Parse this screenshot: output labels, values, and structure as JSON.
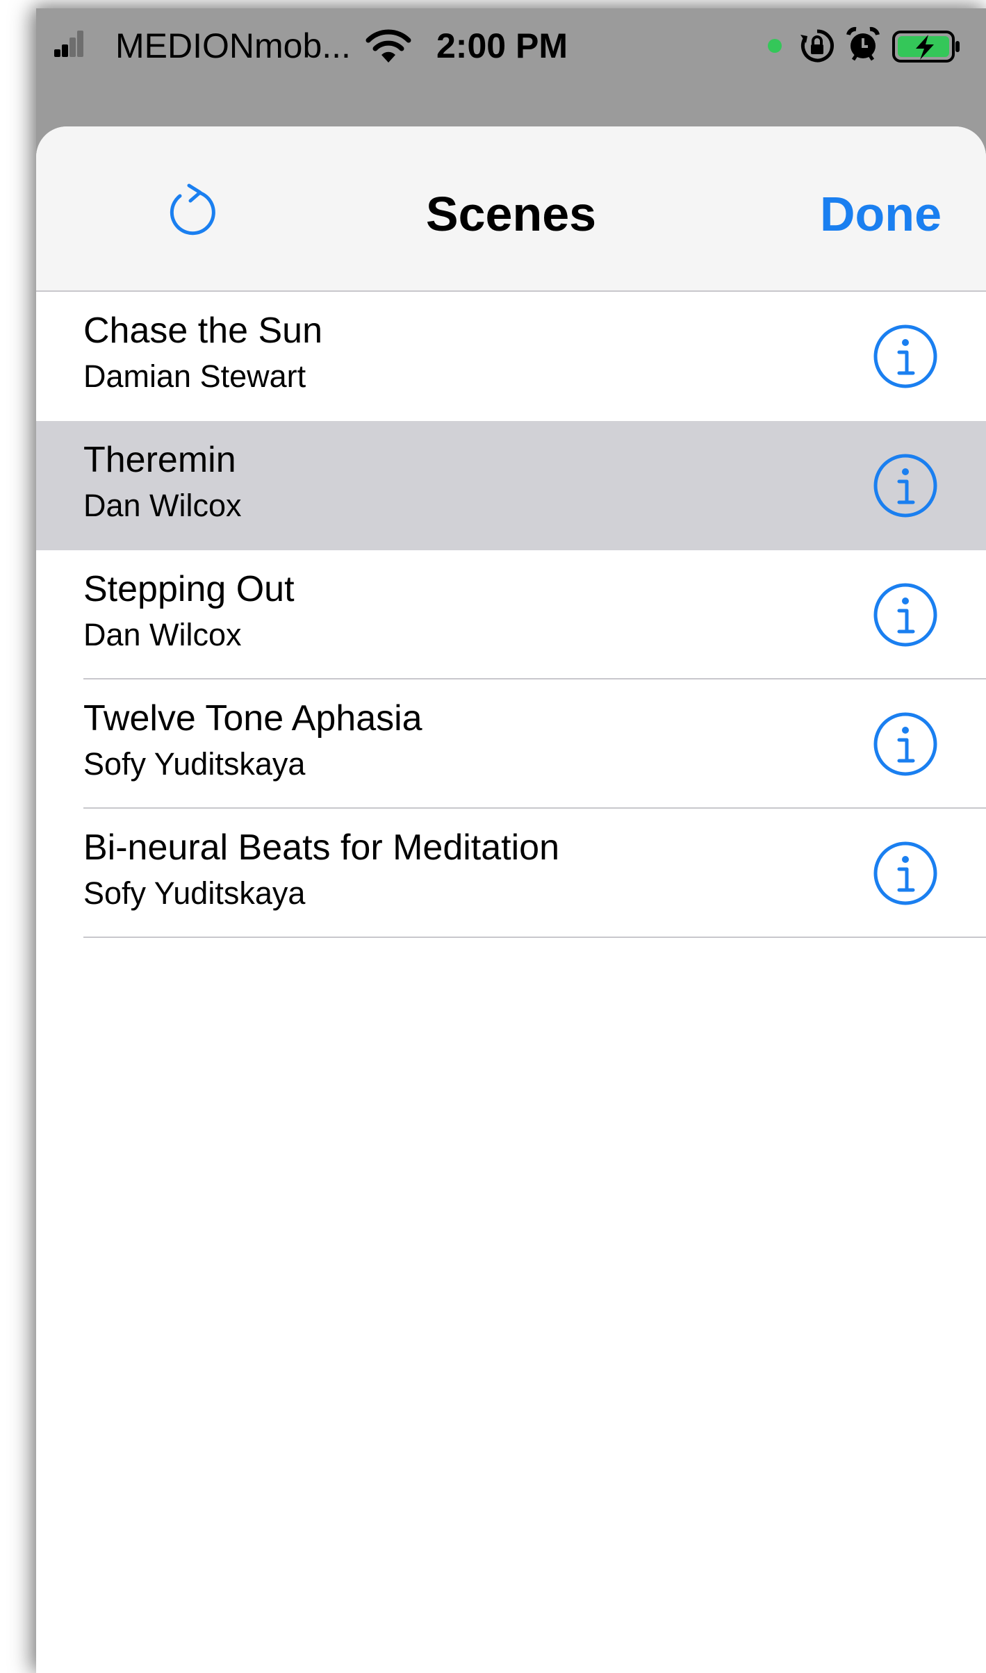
{
  "status_bar": {
    "carrier": "MEDIONmob...",
    "time": "2:00 PM",
    "icons": [
      "signal-icon",
      "wifi-icon",
      "camera-in-use-dot",
      "orientation-lock-icon",
      "alarm-icon",
      "battery-charging-icon"
    ]
  },
  "nav": {
    "title": "Scenes",
    "left_icon": "refresh-icon",
    "done_label": "Done"
  },
  "scenes": [
    {
      "title": "Chase the Sun",
      "author": "Damian Stewart",
      "selected": false
    },
    {
      "title": "Theremin",
      "author": "Dan Wilcox",
      "selected": true
    },
    {
      "title": "Stepping Out",
      "author": "Dan Wilcox",
      "selected": false
    },
    {
      "title": "Twelve Tone Aphasia",
      "author": "Sofy Yuditskaya",
      "selected": false
    },
    {
      "title": "Bi-neural Beats for Meditation",
      "author": "Sofy Yuditskaya",
      "selected": false
    }
  ],
  "colors": {
    "accent": "#1a7ff0",
    "selected_row": "#d1d1d6",
    "nav_background": "#f5f5f5",
    "dimmed_background": "#9b9b9b",
    "battery_fill": "#34c759"
  }
}
